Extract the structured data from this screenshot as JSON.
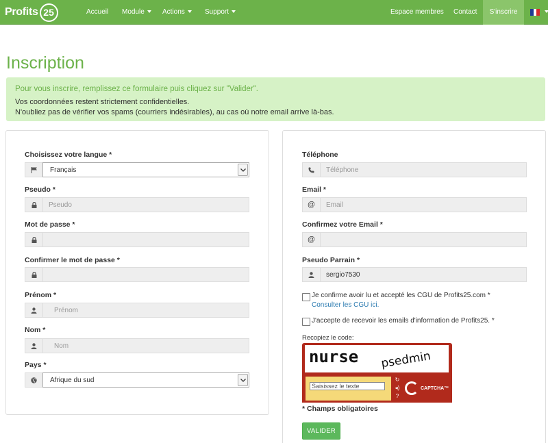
{
  "brand": {
    "text": "Profits",
    "number": "25"
  },
  "nav": {
    "accueil": "Accueil",
    "module": "Module",
    "actions": "Actions",
    "support": "Support",
    "espace_membres": "Espace membres",
    "contact": "Contact",
    "sinscrire": "S'inscrire",
    "language_flag": "french-flag-icon"
  },
  "page": {
    "title": "Inscription",
    "alert_intro": "Pour vous inscrire, remplissez ce formulaire puis cliquez sur \"Valider\".",
    "alert_line1": "Vos coordonnées restent strictement confidentielles.",
    "alert_line2": "N'oubliez pas de vérifier vos spams (courriers indésirables), au cas où notre email arrive là-bas."
  },
  "left": {
    "langue": {
      "label": "Choisissez votre langue *",
      "value": "Français",
      "icon": "flag-icon"
    },
    "pseudo": {
      "label": "Pseudo *",
      "placeholder": "Pseudo",
      "icon": "lock-icon"
    },
    "mot_de_passe": {
      "label": "Mot de passe *",
      "placeholder": "",
      "icon": "lock-icon"
    },
    "confirmer_mdp": {
      "label": "Confirmer le mot de passe *",
      "placeholder": "",
      "icon": "lock-icon"
    },
    "prenom": {
      "label": "Prénom *",
      "placeholder": "Prénom",
      "icon": "user-icon"
    },
    "nom": {
      "label": "Nom *",
      "placeholder": "Nom",
      "icon": "user-icon"
    },
    "pays": {
      "label": "Pays *",
      "value": "Afrique du sud",
      "icon": "globe-icon"
    }
  },
  "right": {
    "telephone": {
      "label": "Téléphone",
      "placeholder": "Téléphone",
      "icon": "phone-icon"
    },
    "email": {
      "label": "Email *",
      "placeholder": "Email",
      "icon": "at-icon",
      "addon": "@"
    },
    "confirm_email": {
      "label": "Confirmez votre Email *",
      "placeholder": "",
      "icon": "at-icon",
      "addon": "@"
    },
    "parrain": {
      "label": "Pseudo Parrain *",
      "value": "sergio7530",
      "icon": "user-icon"
    },
    "cgu": {
      "text": "Je confirme avoir lu et accepté les CGU de Profits25.com *",
      "link": "Consulter les CGU ici.",
      "checked": false
    },
    "emails": {
      "text": "J'accepte de recevoir les emails d'information de Profits25. *",
      "checked": false
    },
    "captcha_label": "Recopiez le code:",
    "captcha": {
      "placeholder": "Saisissez le texte",
      "logo": "CAPTCHA™",
      "words": [
        "nurse",
        "psedmin"
      ]
    },
    "required_note": "* Champs obligatoires",
    "submit": "VALIDER"
  },
  "colors": {
    "brand_green": "#6cb24a",
    "alert_bg": "#d6f2c6",
    "captcha_red": "#b12a1c",
    "button_green": "#5cb85c",
    "link_blue": "#2a7ab0"
  }
}
